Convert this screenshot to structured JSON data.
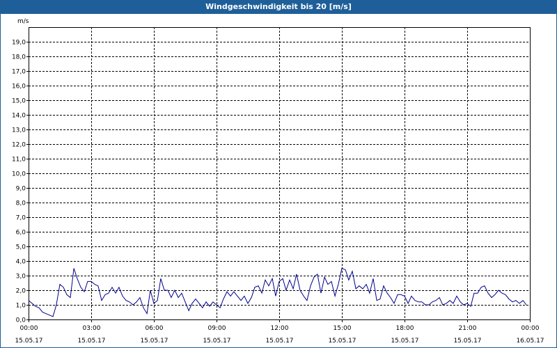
{
  "window": {
    "title": "Windgeschwindigkeit bis 20 [m/s]"
  },
  "chart_data": {
    "type": "line",
    "title": "Windgeschwindigkeit bis 20 [m/s]",
    "ylabel": "m/s",
    "xlabel": "",
    "ylim": [
      0,
      20
    ],
    "xlim": [
      0,
      24
    ],
    "grid": true,
    "line_color": "#00008b",
    "y_ticks": [
      "0,0",
      "1,0",
      "2,0",
      "3,0",
      "4,0",
      "5,0",
      "6,0",
      "7,0",
      "8,0",
      "9,0",
      "10,0",
      "11,0",
      "12,0",
      "13,0",
      "14,0",
      "15,0",
      "16,0",
      "17,0",
      "18,0",
      "19,0"
    ],
    "x_ticks": [
      {
        "time": "00:00",
        "date": "15.05.17"
      },
      {
        "time": "03:00",
        "date": "15.05.17"
      },
      {
        "time": "06:00",
        "date": "15.05.17"
      },
      {
        "time": "09:00",
        "date": "15.05.17"
      },
      {
        "time": "12:00",
        "date": "15.05.17"
      },
      {
        "time": "15:00",
        "date": "15.05.17"
      },
      {
        "time": "18:00",
        "date": "15.05.17"
      },
      {
        "time": "21:00",
        "date": "15.05.17"
      },
      {
        "time": "00:00",
        "date": "16.05.17"
      }
    ],
    "series": [
      {
        "values": [
          [
            0.0,
            1.3
          ],
          [
            0.17,
            1.1
          ],
          [
            0.33,
            0.9
          ],
          [
            0.5,
            0.8
          ],
          [
            0.67,
            0.5
          ],
          [
            0.83,
            0.4
          ],
          [
            1.0,
            0.3
          ],
          [
            1.17,
            0.2
          ],
          [
            1.33,
            1.0
          ],
          [
            1.5,
            2.4
          ],
          [
            1.67,
            2.2
          ],
          [
            1.83,
            1.7
          ],
          [
            2.0,
            1.5
          ],
          [
            2.17,
            3.5
          ],
          [
            2.33,
            2.8
          ],
          [
            2.5,
            2.2
          ],
          [
            2.67,
            1.9
          ],
          [
            2.83,
            2.6
          ],
          [
            3.0,
            2.6
          ],
          [
            3.17,
            2.4
          ],
          [
            3.33,
            2.3
          ],
          [
            3.5,
            1.3
          ],
          [
            3.67,
            1.7
          ],
          [
            3.83,
            1.8
          ],
          [
            4.0,
            2.2
          ],
          [
            4.17,
            1.8
          ],
          [
            4.33,
            2.2
          ],
          [
            4.5,
            1.6
          ],
          [
            4.67,
            1.3
          ],
          [
            4.83,
            1.2
          ],
          [
            5.0,
            1.0
          ],
          [
            5.17,
            1.2
          ],
          [
            5.33,
            1.5
          ],
          [
            5.5,
            0.8
          ],
          [
            5.67,
            0.4
          ],
          [
            5.83,
            2.0
          ],
          [
            6.0,
            1.1
          ],
          [
            6.17,
            1.3
          ],
          [
            6.33,
            2.8
          ],
          [
            6.5,
            2.0
          ],
          [
            6.67,
            2.0
          ],
          [
            6.83,
            1.5
          ],
          [
            7.0,
            2.0
          ],
          [
            7.17,
            1.5
          ],
          [
            7.33,
            1.8
          ],
          [
            7.5,
            1.2
          ],
          [
            7.67,
            0.6
          ],
          [
            7.83,
            1.1
          ],
          [
            8.0,
            1.4
          ],
          [
            8.17,
            1.1
          ],
          [
            8.33,
            0.8
          ],
          [
            8.5,
            1.2
          ],
          [
            8.67,
            0.9
          ],
          [
            8.83,
            1.2
          ],
          [
            9.0,
            1.0
          ],
          [
            9.17,
            0.8
          ],
          [
            9.33,
            1.4
          ],
          [
            9.5,
            1.9
          ],
          [
            9.67,
            1.6
          ],
          [
            9.83,
            1.9
          ],
          [
            10.0,
            1.6
          ],
          [
            10.17,
            1.3
          ],
          [
            10.33,
            1.6
          ],
          [
            10.5,
            1.1
          ],
          [
            10.67,
            1.5
          ],
          [
            10.83,
            2.2
          ],
          [
            11.0,
            2.3
          ],
          [
            11.17,
            1.8
          ],
          [
            11.33,
            2.7
          ],
          [
            11.5,
            2.3
          ],
          [
            11.67,
            2.8
          ],
          [
            11.83,
            1.6
          ],
          [
            12.0,
            2.6
          ],
          [
            12.17,
            2.8
          ],
          [
            12.33,
            2.0
          ],
          [
            12.5,
            2.7
          ],
          [
            12.67,
            2.1
          ],
          [
            12.83,
            3.1
          ],
          [
            13.0,
            2.0
          ],
          [
            13.17,
            1.6
          ],
          [
            13.33,
            1.3
          ],
          [
            13.5,
            2.3
          ],
          [
            13.67,
            2.9
          ],
          [
            13.83,
            3.1
          ],
          [
            14.0,
            1.8
          ],
          [
            14.17,
            2.9
          ],
          [
            14.33,
            2.4
          ],
          [
            14.5,
            2.6
          ],
          [
            14.67,
            1.6
          ],
          [
            14.83,
            2.4
          ],
          [
            15.0,
            3.5
          ],
          [
            15.17,
            3.4
          ],
          [
            15.33,
            2.7
          ],
          [
            15.5,
            3.3
          ],
          [
            15.67,
            2.1
          ],
          [
            15.83,
            2.3
          ],
          [
            16.0,
            2.1
          ],
          [
            16.17,
            2.4
          ],
          [
            16.33,
            1.8
          ],
          [
            16.5,
            2.8
          ],
          [
            16.67,
            1.3
          ],
          [
            16.83,
            1.4
          ],
          [
            17.0,
            2.3
          ],
          [
            17.17,
            1.8
          ],
          [
            17.33,
            1.5
          ],
          [
            17.5,
            1.1
          ],
          [
            17.67,
            1.7
          ],
          [
            17.83,
            1.7
          ],
          [
            18.0,
            1.6
          ],
          [
            18.17,
            1.1
          ],
          [
            18.33,
            1.6
          ],
          [
            18.5,
            1.3
          ],
          [
            18.67,
            1.2
          ],
          [
            18.83,
            1.2
          ],
          [
            19.0,
            1.0
          ],
          [
            19.17,
            1.0
          ],
          [
            19.33,
            1.2
          ],
          [
            19.5,
            1.3
          ],
          [
            19.67,
            1.5
          ],
          [
            19.83,
            1.0
          ],
          [
            20.0,
            1.1
          ],
          [
            20.17,
            1.3
          ],
          [
            20.33,
            1.1
          ],
          [
            20.5,
            1.6
          ],
          [
            20.67,
            1.2
          ],
          [
            20.83,
            1.0
          ],
          [
            21.0,
            1.1
          ],
          [
            21.17,
            0.9
          ],
          [
            21.33,
            1.8
          ],
          [
            21.5,
            1.8
          ],
          [
            21.67,
            2.2
          ],
          [
            21.83,
            2.3
          ],
          [
            22.0,
            1.8
          ],
          [
            22.17,
            1.5
          ],
          [
            22.33,
            1.7
          ],
          [
            22.5,
            2.0
          ],
          [
            22.67,
            1.8
          ],
          [
            22.83,
            1.7
          ],
          [
            23.0,
            1.4
          ],
          [
            23.17,
            1.2
          ],
          [
            23.33,
            1.3
          ],
          [
            23.5,
            1.1
          ],
          [
            23.67,
            1.3
          ],
          [
            23.83,
            1.0
          ]
        ]
      }
    ]
  }
}
